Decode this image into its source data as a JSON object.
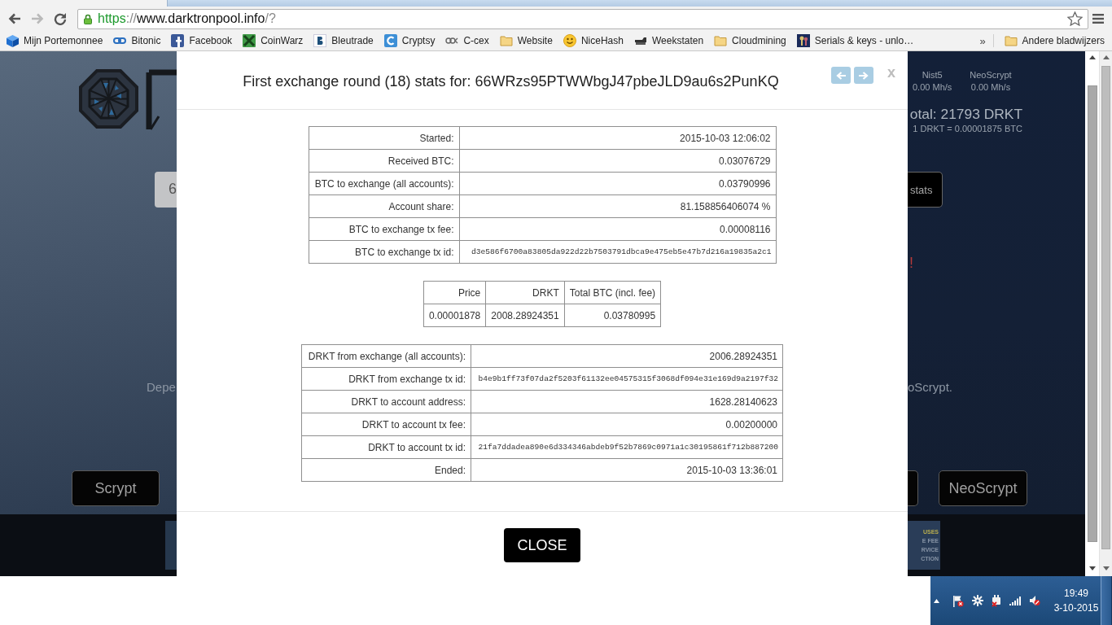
{
  "browser": {
    "address_bar": [
      {
        "text": "https",
        "kind": "secure"
      },
      {
        "text": "://",
        "kind": "muted"
      },
      {
        "text": "www.darktronpool.info",
        "kind": "host"
      },
      {
        "text": "/?",
        "kind": "muted"
      }
    ],
    "bookmarks": [
      {
        "label": "Mijn Portemonnee",
        "kind": "cube"
      },
      {
        "label": "Bitonic",
        "kind": "link"
      },
      {
        "label": "Facebook",
        "kind": "fb"
      },
      {
        "label": "CoinWarz",
        "kind": "cross"
      },
      {
        "label": "Bleutrade",
        "kind": "btile"
      },
      {
        "label": "Cryptsy",
        "kind": "ctile"
      },
      {
        "label": "C-cex",
        "kind": "rings"
      },
      {
        "label": "Website",
        "kind": "folder"
      },
      {
        "label": "NiceHash",
        "kind": "smiley"
      },
      {
        "label": "Weekstaten",
        "kind": "device"
      },
      {
        "label": "Cloudmining",
        "kind": "folder"
      },
      {
        "label": "Serials & keys - unlo…",
        "kind": "keys"
      }
    ],
    "overflow": "»",
    "other_bookmarks": {
      "label": "Andere bladwijzers",
      "kind": "folder"
    }
  },
  "page": {
    "left": {
      "address_value": "6",
      "text": "Depe",
      "button": "Scrypt"
    },
    "right": {
      "hashrates": [
        {
          "algorithm": "Nist5",
          "rate": "0.00 Mh/s"
        },
        {
          "algorithm": "NeoScrypt",
          "rate": "0.00 Mh/s"
        }
      ],
      "total": "otal: 21793 DRKT",
      "rate": "1 DRKT = 0.00001875 BTC",
      "stats_button": "stats",
      "alert": "!",
      "text": "oScrypt.",
      "button": "NeoScrypt"
    },
    "banner": [
      {
        "text": "USES",
        "kind": "accent"
      },
      {
        "text": "E FEE",
        "kind": "plain"
      },
      {
        "text": "RVICE",
        "kind": "plain"
      },
      {
        "text": "CTION",
        "kind": "plain"
      }
    ]
  },
  "modal": {
    "title": "First exchange round (18) stats for: 66WRzs95PTWWbgJ47pbeJLD9au6s2PunKQ",
    "dismiss": "x",
    "round": [
      {
        "label": "Started:",
        "value": "2015-10-03 12:06:02",
        "kind": "text"
      },
      {
        "label": "Received BTC:",
        "value": "0.03076729",
        "kind": "text"
      },
      {
        "label": "BTC to exchange (all accounts):",
        "value": "0.03790996",
        "kind": "text"
      },
      {
        "label": "Account share:",
        "value": "81.158856406074 %",
        "kind": "text"
      },
      {
        "label": "BTC to exchange tx fee:",
        "value": "0.00008116",
        "kind": "text"
      },
      {
        "label": "BTC to exchange tx id:",
        "value": "d3e586f6700a83805da922d22b7503791dbca9e475eb5e47b7d216a19835a2c1",
        "kind": "hash"
      }
    ],
    "trade": {
      "columns": [
        "Price",
        "DRKT",
        "Total BTC (incl. fee)"
      ],
      "rows": [
        [
          "0.00001878",
          "2008.28924351",
          "0.03780995"
        ]
      ]
    },
    "payout": [
      {
        "label": "DRKT from exchange (all accounts):",
        "value": "2006.28924351",
        "kind": "text"
      },
      {
        "label": "DRKT from exchange tx id:",
        "value": "b4e9b1ff73f07da2f5203f61132ee04575315f3068df094e31e169d9a2197f32",
        "kind": "hash"
      },
      {
        "label": "DRKT to account address:",
        "value": "1628.28140623",
        "kind": "text"
      },
      {
        "label": "DRKT to account tx fee:",
        "value": "0.00200000",
        "kind": "text"
      },
      {
        "label": "DRKT to account tx id:",
        "value": "21fa7ddadea890e6d334346abdeb9f52b7869c0971a1c30195861f712b887200",
        "kind": "hash"
      },
      {
        "label": "Ended:",
        "value": "2015-10-03 13:36:01",
        "kind": "text"
      }
    ],
    "close_button": "CLOSE"
  },
  "taskbar": {
    "time": "19:49",
    "date": "3-10-2015"
  }
}
